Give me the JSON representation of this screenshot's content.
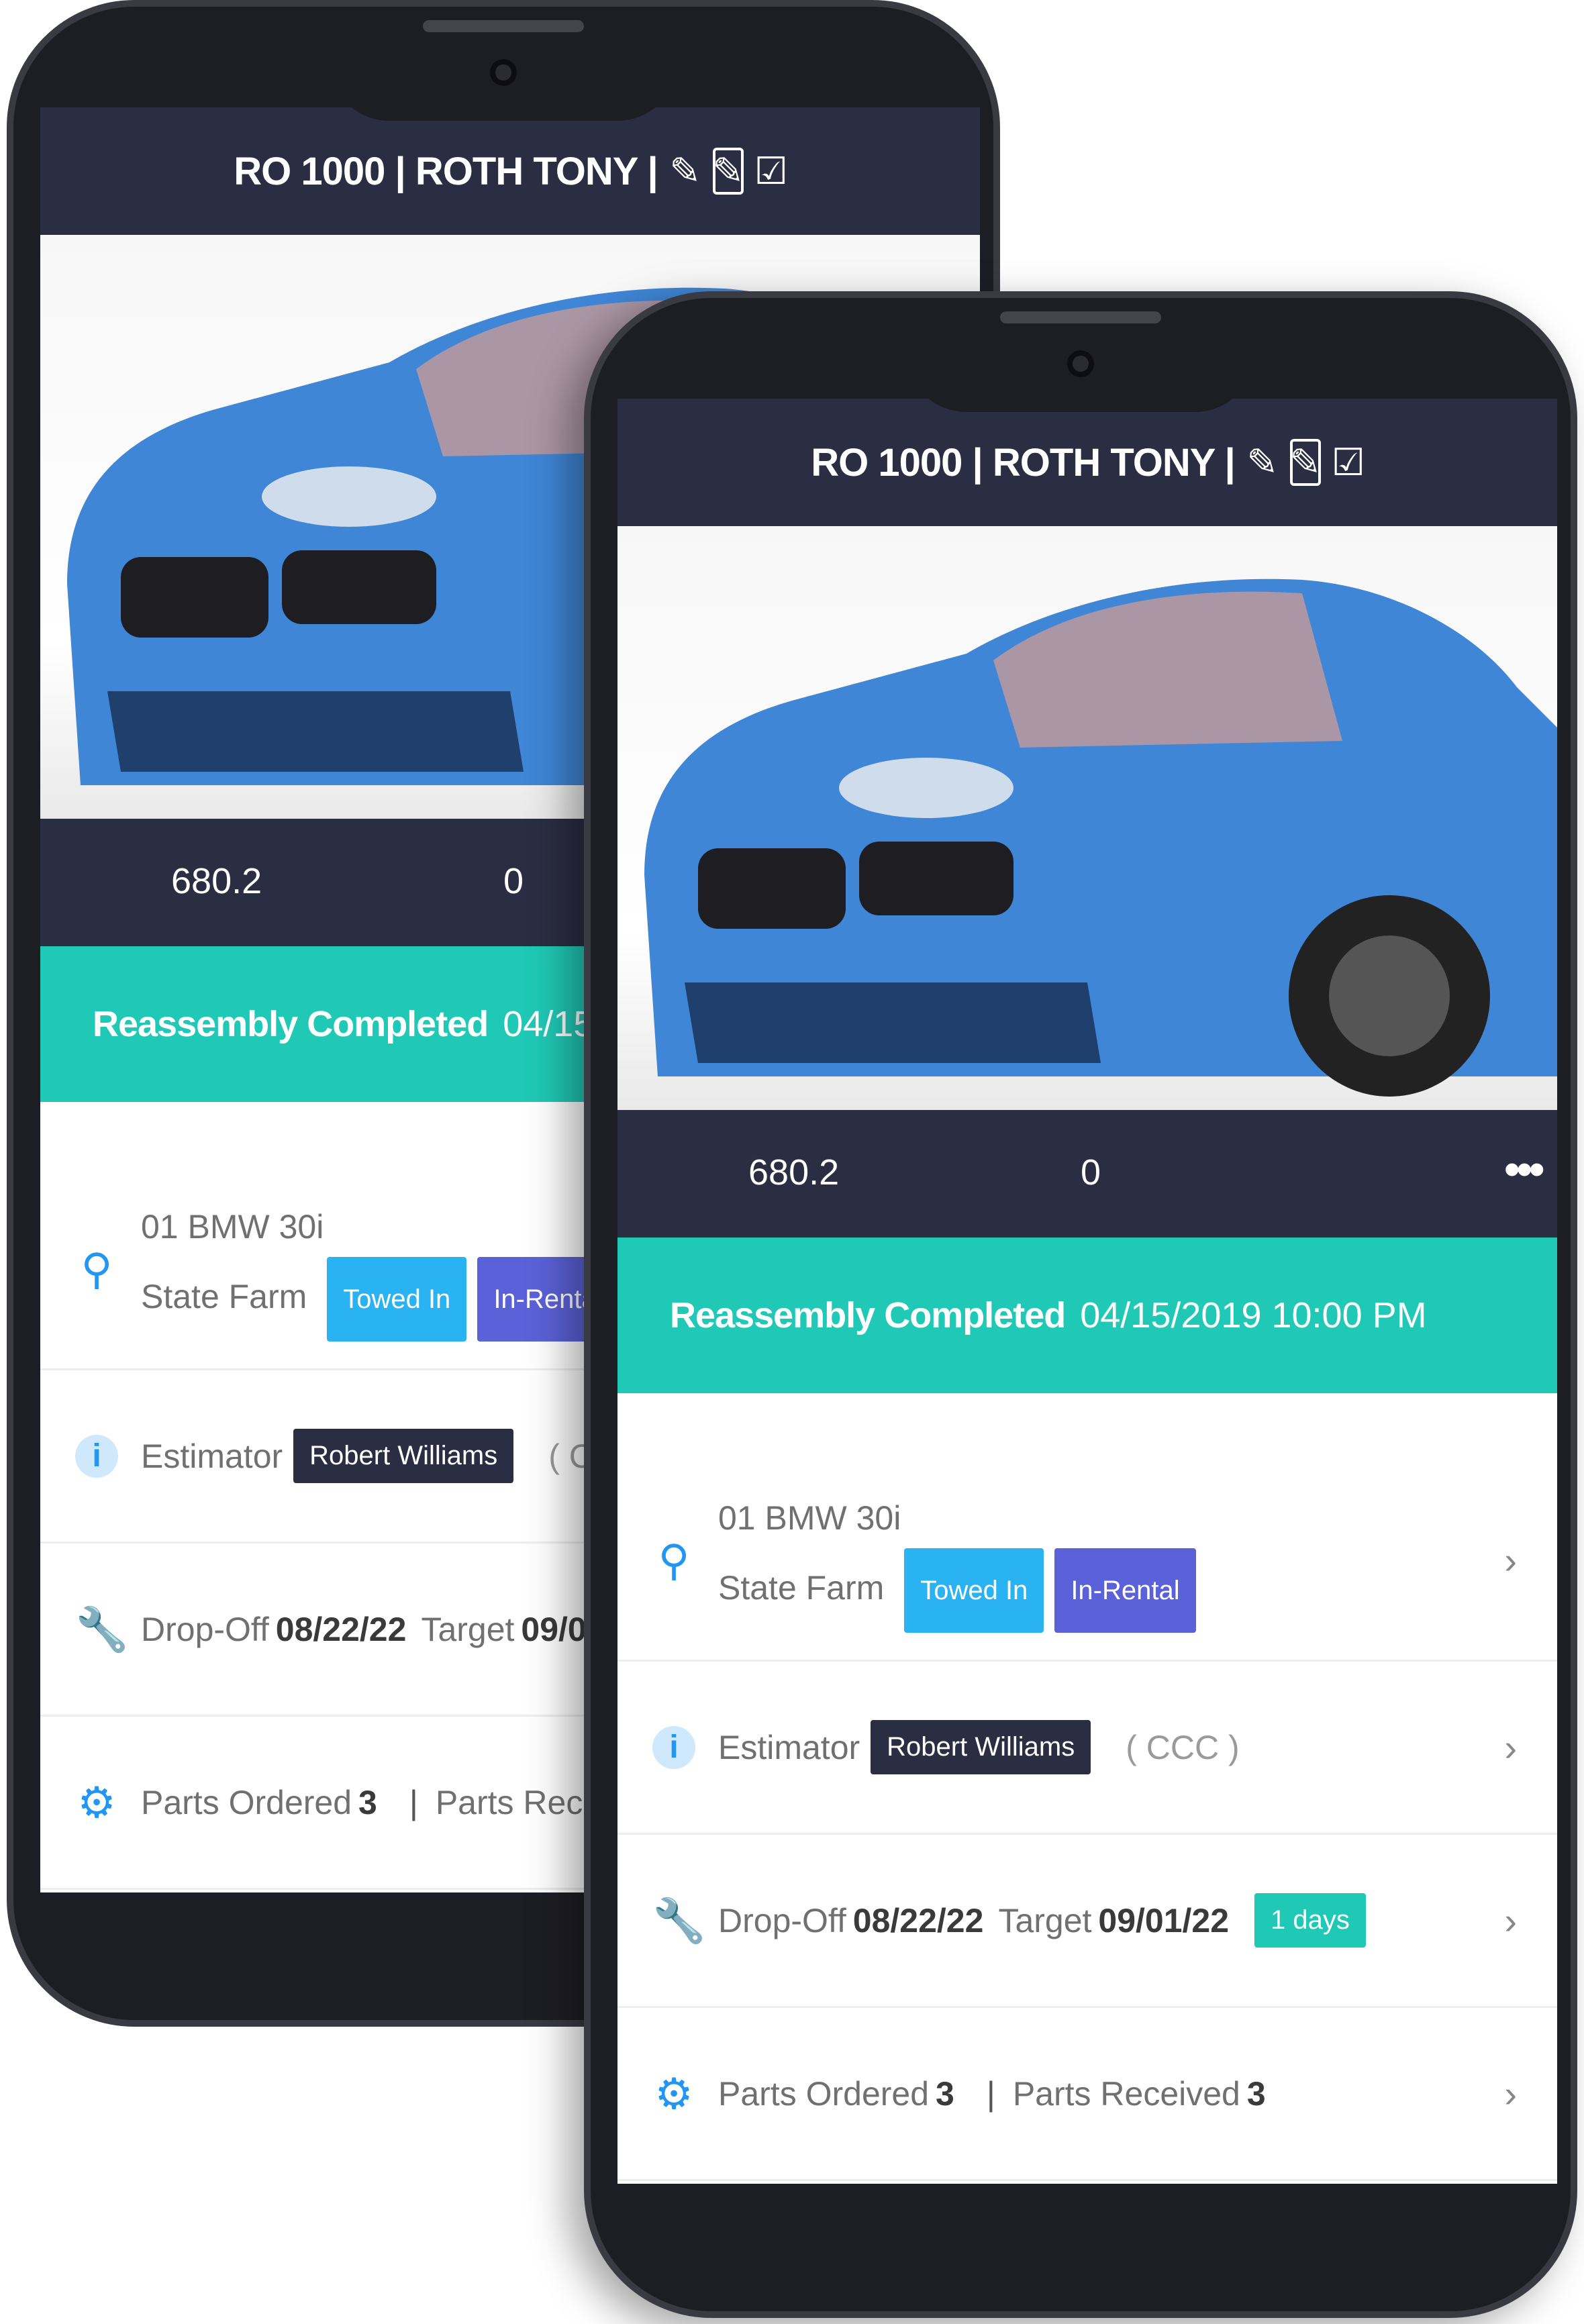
{
  "header": {
    "title": "RO 1000 | ROTH TONY |"
  },
  "stats": {
    "amount": "680.2",
    "count": "0"
  },
  "status": {
    "label": "Reassembly Completed",
    "datetime": "04/15/2019 10:00 PM"
  },
  "vehicle": {
    "name": "01 BMW 30i",
    "insurer": "State Farm",
    "tags": [
      "Towed In",
      "In-Rental"
    ]
  },
  "estimator": {
    "label": "Estimator",
    "name": "Robert Williams",
    "system": "( CCC )"
  },
  "dates": {
    "dropoff_label": "Drop-Off",
    "dropoff": "08/22/22",
    "target_label": "Target",
    "target": "09/01/22",
    "days": "1 days"
  },
  "parts": {
    "ordered_label": "Parts Ordered",
    "ordered": "3",
    "received_label": "Parts Received",
    "received": "3"
  },
  "icons": [
    "pencil-icon",
    "edit-icon",
    "checkbox-icon",
    "key-icon",
    "info-icon",
    "wrench-icon",
    "gear-icon",
    "chevron-right-icon",
    "more-icon"
  ],
  "colors": {
    "header": "#2b2d42",
    "status": "#20c9b5",
    "towed": "#29b3f2",
    "rental": "#5b62d9",
    "icon": "#2196f3"
  }
}
